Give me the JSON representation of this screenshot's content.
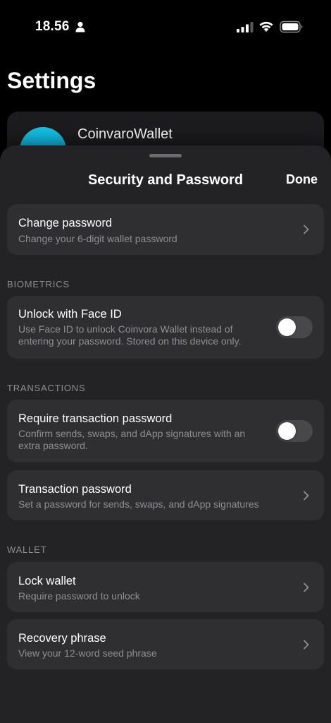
{
  "status_bar": {
    "time": "18.56"
  },
  "page": {
    "title": "Settings"
  },
  "account": {
    "name": "CoinvaroWallet"
  },
  "sheet": {
    "title": "Security and Password",
    "done_label": "Done",
    "change_password": {
      "title": "Change password",
      "subtitle": "Change your 6-digit wallet password"
    },
    "sections": {
      "biometrics": "BIOMETRICS",
      "transactions": "TRANSACTIONS",
      "wallet": "WALLET"
    },
    "face_id": {
      "title": "Unlock with Face ID",
      "subtitle": "Use Face ID to unlock Coinvora Wallet instead of entering your password. Stored on this device only.",
      "enabled": false
    },
    "require_tx_password": {
      "title": "Require transaction password",
      "subtitle": "Confirm sends, swaps, and dApp signatures with an extra password.",
      "enabled": false
    },
    "tx_password": {
      "title": "Transaction password",
      "subtitle": "Set a password for sends, swaps, and dApp signatures"
    },
    "lock_wallet": {
      "title": "Lock wallet",
      "subtitle": "Require password to unlock"
    },
    "recovery_phrase": {
      "title": "Recovery phrase",
      "subtitle": "View your 12-word seed phrase"
    }
  }
}
